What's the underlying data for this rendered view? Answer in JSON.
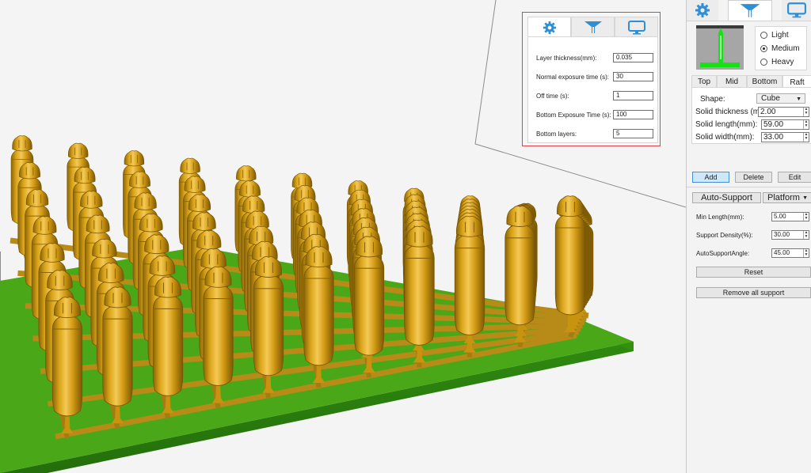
{
  "popup": {
    "fields": [
      {
        "label": "Layer thickness(mm):",
        "value": "0.035"
      },
      {
        "label": "Normal exposure time (s):",
        "value": "30"
      },
      {
        "label": "Off time (s):",
        "value": "1"
      },
      {
        "label": "Bottom Exposure Time (s):",
        "value": "100"
      },
      {
        "label": "Bottom layers:",
        "value": "5"
      }
    ]
  },
  "support_density": {
    "options": [
      "Light",
      "Medium",
      "Heavy"
    ],
    "selected": "Medium"
  },
  "raft": {
    "tabs": [
      "Top",
      "Mid",
      "Bottom",
      "Raft"
    ],
    "active_tab": "Raft",
    "shape_label": "Shape:",
    "shape_value": "Cube",
    "fields": [
      {
        "label": "Solid thickness (mm):",
        "value": "2.00"
      },
      {
        "label": "Solid length(mm):",
        "value": "59.00"
      },
      {
        "label": "Solid width(mm):",
        "value": "33.00"
      }
    ]
  },
  "actions": {
    "add": "Add",
    "delete": "Delete",
    "edit": "Edit"
  },
  "auto_support": {
    "button": "Auto-Support",
    "target": "Platform",
    "fields": [
      {
        "label": "Min Length(mm):",
        "value": "5.00"
      },
      {
        "label": "Support Density(%):",
        "value": "30.00"
      },
      {
        "label": "AutoSupportAngle:",
        "value": "45.00"
      }
    ],
    "reset": "Reset",
    "remove_all": "Remove all support"
  },
  "colors": {
    "accent_blue": "#2e8fd4",
    "platform_green": "#4aa818",
    "model_gold": "#d9a317",
    "highlight_red": "#e0404a"
  },
  "icons": {
    "tab1": "gear-icon",
    "tab2": "support-icon",
    "tab3": "monitor-icon"
  }
}
